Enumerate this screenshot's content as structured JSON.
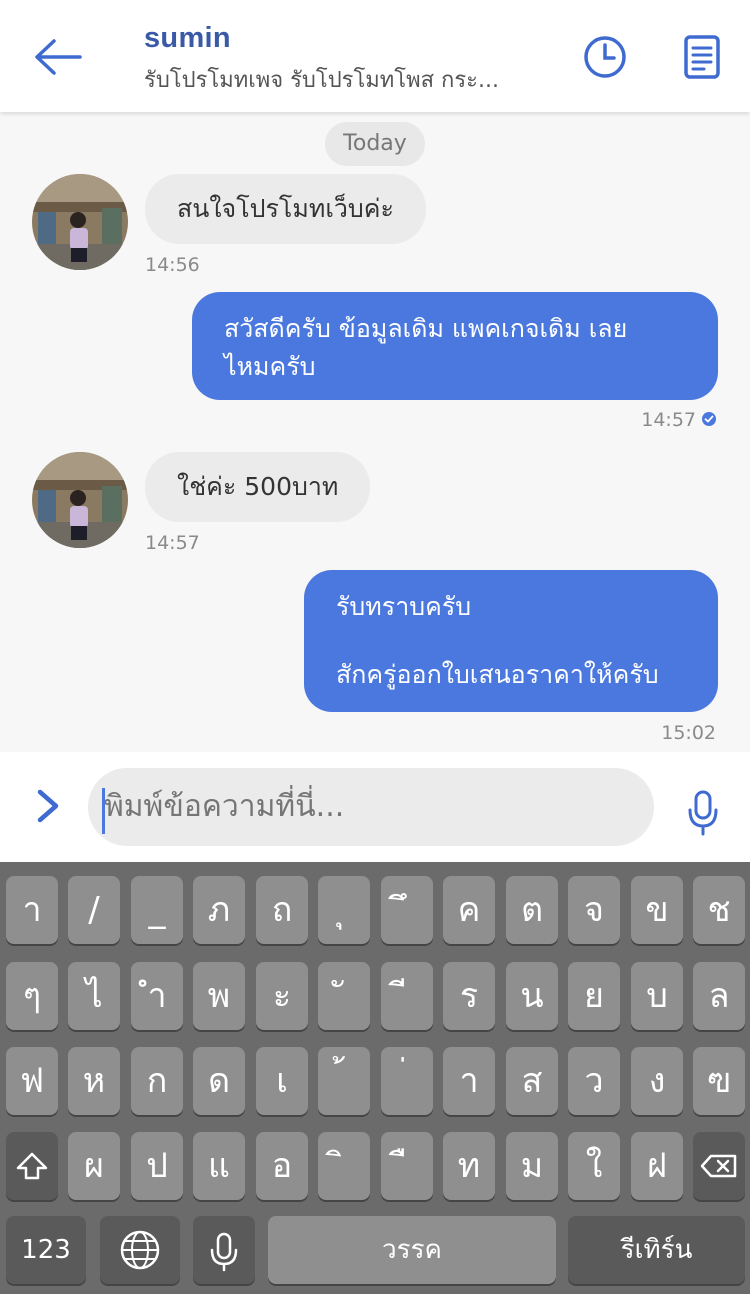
{
  "header": {
    "title": "sumin",
    "subtitle": "รับโปรโมทเพจ รับโปรโมทโพส กระ..."
  },
  "chat": {
    "date_chip": "Today",
    "messages": [
      {
        "direction": "in",
        "text": "สนใจโปรโมทเว็บค่ะ",
        "time": "14:56"
      },
      {
        "direction": "out",
        "lines": [
          "สวัสดีครับ ข้อมูลเดิม แพคเกจเดิม เลย",
          "ไหมครับ"
        ],
        "time": "14:57",
        "read": true
      },
      {
        "direction": "in",
        "text": "ใช่ค่ะ 500บาท",
        "time": "14:57"
      },
      {
        "direction": "out",
        "lines": [
          "รับทราบครับ",
          "",
          "สักครู่ออกใบเสนอราคาให้ครับ"
        ],
        "time": "15:02"
      }
    ]
  },
  "composer": {
    "placeholder": "พิมพ์ข้อความที่นี่..."
  },
  "keyboard": {
    "row1": [
      "า",
      "/",
      "_",
      "ภ",
      "ถ",
      "ุ",
      "ึ",
      "ค",
      "ต",
      "จ",
      "ข",
      "ช"
    ],
    "row2": [
      "ๆ",
      "ไ",
      "ำ",
      "พ",
      "ะ",
      "ั",
      "ี",
      "ร",
      "น",
      "ย",
      "บ",
      "ล"
    ],
    "row3": [
      "ฟ",
      "ห",
      "ก",
      "ด",
      "เ",
      "้",
      "่",
      "า",
      "ส",
      "ว",
      "ง",
      "ฃ"
    ],
    "row4": [
      "ผ",
      "ป",
      "แ",
      "อ",
      "ิ",
      "ื",
      "ท",
      "ม",
      "ใ",
      "ฝ"
    ],
    "numbers_label": "123",
    "space_label": "วรรค",
    "return_label": "รีเทิร์น"
  },
  "colors": {
    "accent": "#4a78de",
    "header_title": "#3a5aa8",
    "incoming_bubble": "#ebebeb",
    "keyboard_bg": "#6b6b6b",
    "key": "#8f8f8f"
  }
}
